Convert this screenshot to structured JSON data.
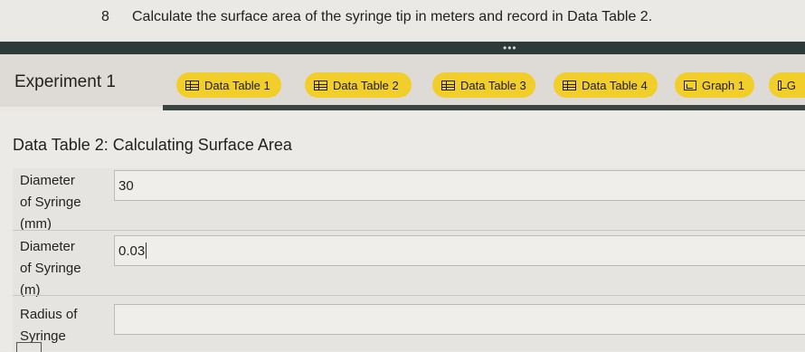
{
  "question": {
    "number": "8",
    "text": "Calculate the surface area of the syringe tip in meters and record in Data Table 2."
  },
  "toolbar": {
    "dots": "•••"
  },
  "tabs": {
    "experiment_title": "Experiment 1",
    "items": [
      {
        "label": "Data Table 1",
        "icon": "table-icon"
      },
      {
        "label": "Data Table 2",
        "icon": "table-icon"
      },
      {
        "label": "Data Table 3",
        "icon": "table-icon"
      },
      {
        "label": "Data Table 4",
        "icon": "table-icon"
      },
      {
        "label": "Graph 1",
        "icon": "chart-icon"
      },
      {
        "label": "G",
        "icon": "chart-icon"
      }
    ],
    "accent_color": "#f1ce2a"
  },
  "data_table": {
    "title": "Data Table 2: Calculating Surface Area",
    "rows": [
      {
        "label_lines": [
          "Diameter",
          "of Syringe",
          "(mm)"
        ],
        "value": "30"
      },
      {
        "label_lines": [
          "Diameter",
          "of Syringe",
          "(m)"
        ],
        "value": "0.03"
      },
      {
        "label_lines": [
          "Radius of",
          "Syringe"
        ],
        "value": ""
      }
    ]
  }
}
